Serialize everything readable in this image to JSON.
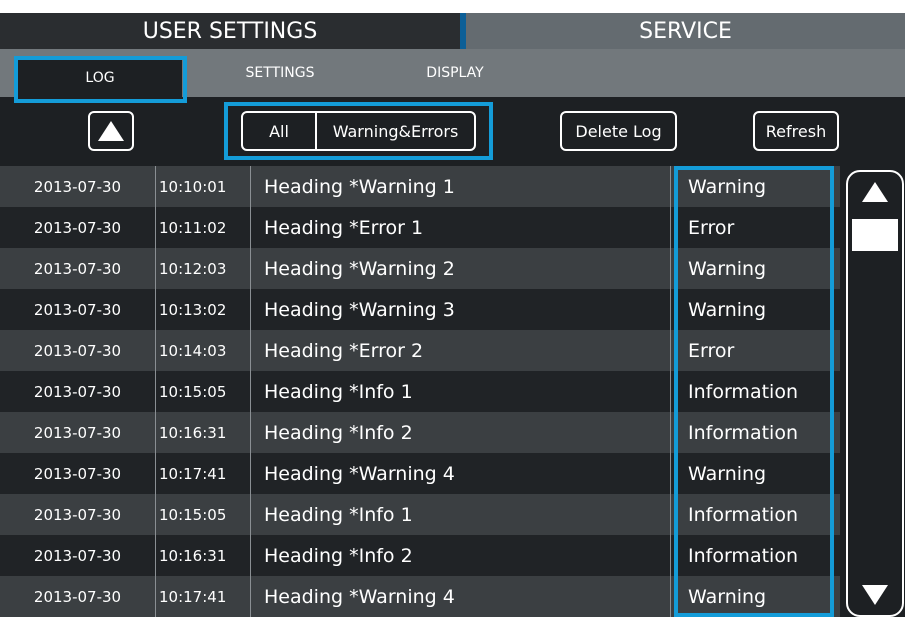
{
  "tabs": {
    "user_settings": "USER SETTINGS",
    "service": "SERVICE"
  },
  "subtabs": {
    "log": "LOG",
    "settings": "SETTINGS",
    "display": "DISPLAY"
  },
  "toolbar": {
    "filter_all": "All",
    "filter_warnings_errors": "Warning&Errors",
    "delete_log": "Delete Log",
    "refresh": "Refresh"
  },
  "log_rows": [
    {
      "date": "2013-07-30",
      "time": "10:10:01",
      "heading": "Heading *Warning 1",
      "type": "Warning"
    },
    {
      "date": "2013-07-30",
      "time": "10:11:02",
      "heading": "Heading *Error 1",
      "type": "Error"
    },
    {
      "date": "2013-07-30",
      "time": "10:12:03",
      "heading": "Heading *Warning 2",
      "type": "Warning"
    },
    {
      "date": "2013-07-30",
      "time": "10:13:02",
      "heading": "Heading *Warning 3",
      "type": "Warning"
    },
    {
      "date": "2013-07-30",
      "time": "10:14:03",
      "heading": "Heading *Error 2",
      "type": "Error"
    },
    {
      "date": "2013-07-30",
      "time": "10:15:05",
      "heading": "Heading *Info 1",
      "type": "Information"
    },
    {
      "date": "2013-07-30",
      "time": "10:16:31",
      "heading": "Heading *Info 2",
      "type": "Information"
    },
    {
      "date": "2013-07-30",
      "time": "10:17:41",
      "heading": "Heading  *Warning 4",
      "type": "Warning"
    },
    {
      "date": "2013-07-30",
      "time": "10:15:05",
      "heading": "Heading *Info 1",
      "type": "Information"
    },
    {
      "date": "2013-07-30",
      "time": "10:16:31",
      "heading": "Heading *Info 2",
      "type": "Information"
    },
    {
      "date": "2013-07-30",
      "time": "10:17:41",
      "heading": "Heading  *Warning 4",
      "type": "Warning"
    }
  ],
  "icons": {
    "page_up": "triangle-up-icon",
    "scroll_up": "triangle-up-icon",
    "scroll_down": "triangle-down-icon"
  },
  "colors": {
    "highlight": "#149cd8",
    "background": "#1d2023",
    "tab_active": "#646b70"
  }
}
